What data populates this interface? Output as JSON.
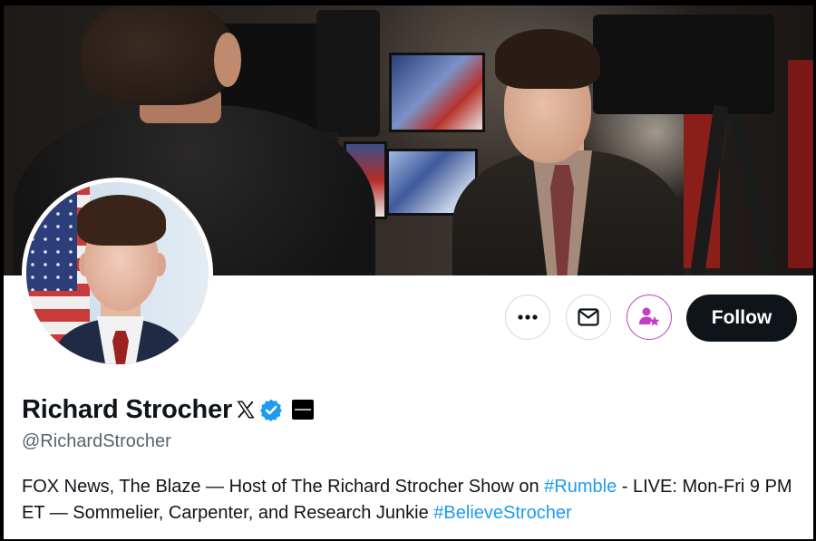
{
  "profile": {
    "display_name": "Richard Strocher",
    "handle": "@RichardStrocher",
    "bio": {
      "part1": "FOX News, The Blaze — Host of The Richard Strocher Show on ",
      "hashtag1": "#Rumble",
      "part2": " - LIVE: Mon-Fri 9 PM ET — Sommelier, Carpenter, and Research Junkie ",
      "hashtag2": "#BelieveStrocher"
    }
  },
  "actions": {
    "more_icon": "ellipsis-icon",
    "message_icon": "envelope-icon",
    "notify_icon": "person-star-icon",
    "follow_label": "Follow"
  },
  "colors": {
    "accent": "#1d9bf0",
    "follow_bg": "#0f1419",
    "notify_ring": "#c03fc4",
    "verified_badge": "#1d9bf0"
  }
}
